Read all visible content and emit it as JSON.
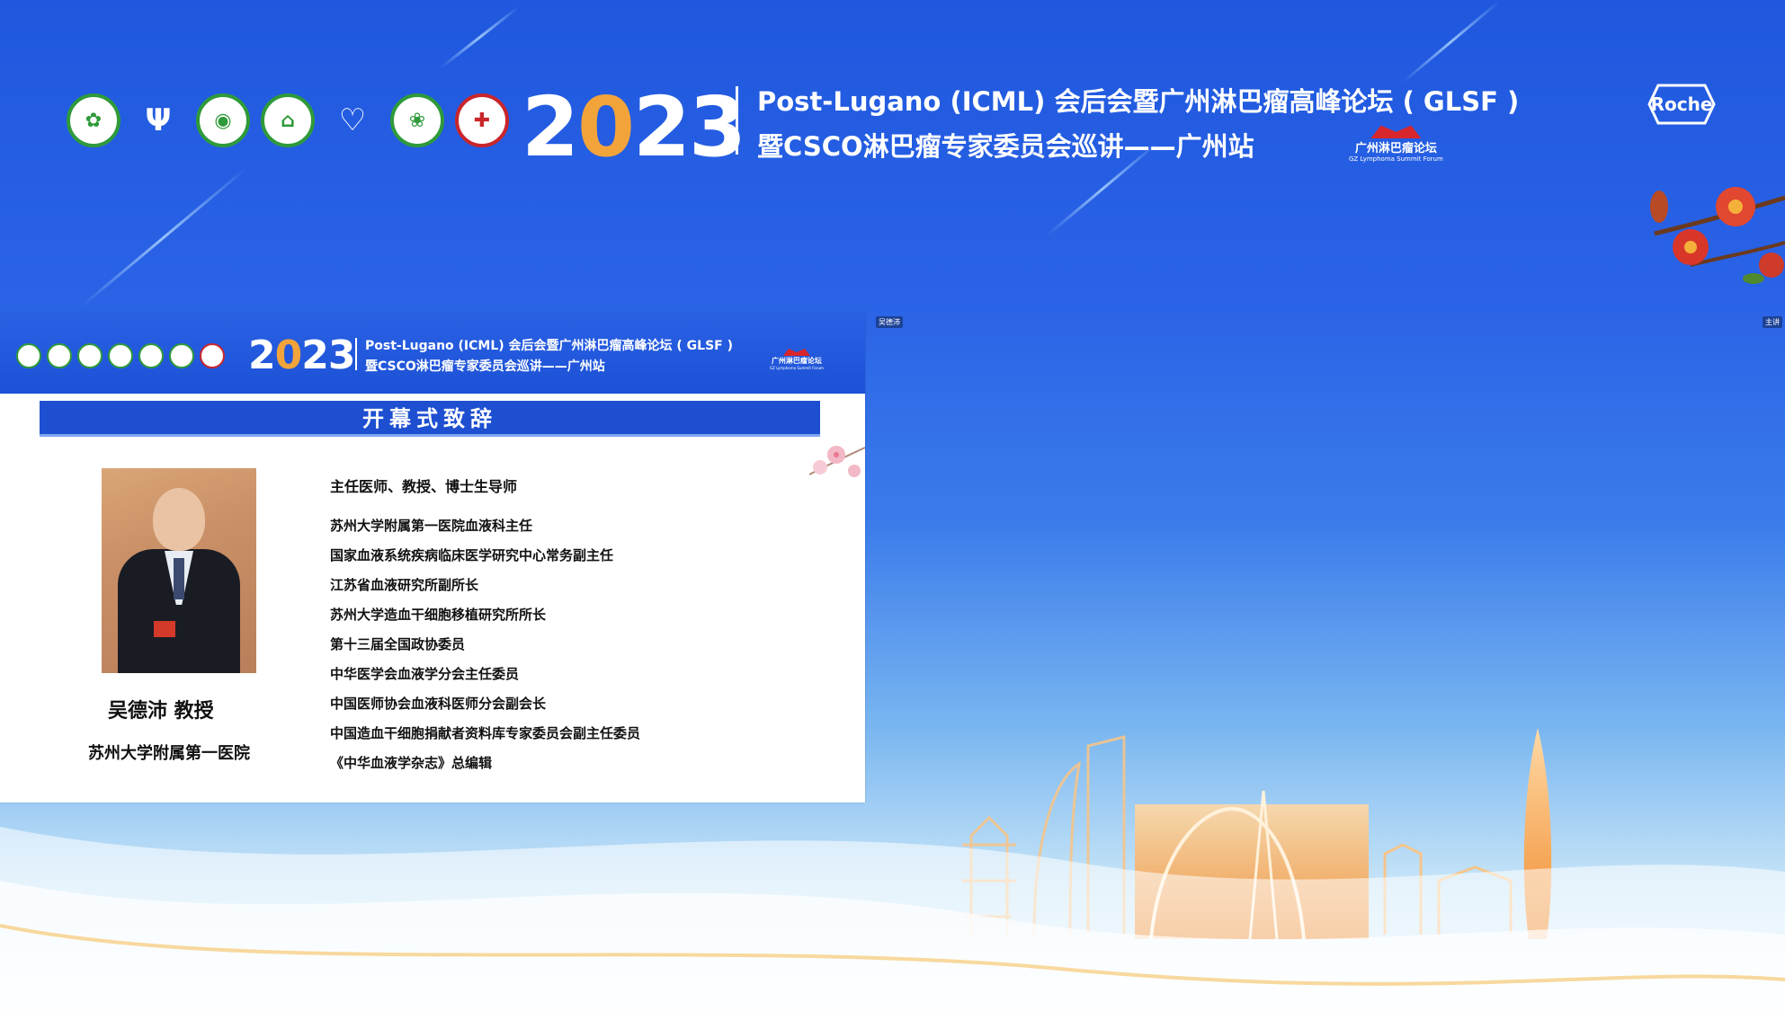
{
  "banner": {
    "year_prefix": "2",
    "year_o": "0",
    "year_suffix": "23",
    "title_line1": "Post-Lugano (ICML) 会后会暨广州淋巴瘤高峰论坛 ( GLSF )",
    "title_line2": "暨CSCO淋巴瘤专家委员会巡讲——广州站",
    "forum_cn": "广州淋巴瘤论坛",
    "forum_en": "GZ Lymphoma Summit Forum",
    "sponsor": "Roche",
    "logo_icons": [
      "green-seal-icon",
      "cscf-figure-icon",
      "green-ring-icon",
      "village-seal-icon",
      "beijing-life-care-icon",
      "green-seal-icon",
      "red-cross-seal-icon"
    ]
  },
  "slide": {
    "year_prefix": "2",
    "year_o": "0",
    "year_suffix": "23",
    "title_line1": "Post-Lugano (ICML) 会后会暨广州淋巴瘤高峰论坛 ( GLSF )",
    "title_line2": "暨CSCO淋巴瘤专家委员会巡讲——广州站",
    "forum_cn": "广州淋巴瘤论坛",
    "forum_en": "GZ Lymphoma Summit Forum",
    "section_title": "开幕式致辞",
    "person_name": "吴德沛  教授",
    "person_org": "苏州大学附属第一医院",
    "bio_main": "主任医师、教授、博士生导师",
    "bio_items": [
      "苏州大学附属第一医院血液科主任",
      "国家血液系统疾病临床医学研究中心常务副主任",
      "江苏省血液研究所副所长",
      "苏州大学造血干细胞移植研究所所长",
      "第十三届全国政协委员",
      "中华医学会血液学分会主任委员",
      "中国医师协会血液科医师分会副会长",
      "中国造血干细胞捐献者资料库专家委员会副主任委员",
      "《中华血液学杂志》总编辑"
    ]
  },
  "tiles": {
    "left_tag": "吴德沛",
    "right_tag": "主讲"
  },
  "colors": {
    "background_blue": "#2a63e6",
    "accent_orange": "#f2a43a",
    "section_blue": "#1d4fd0",
    "brand_red": "#d7262c"
  }
}
